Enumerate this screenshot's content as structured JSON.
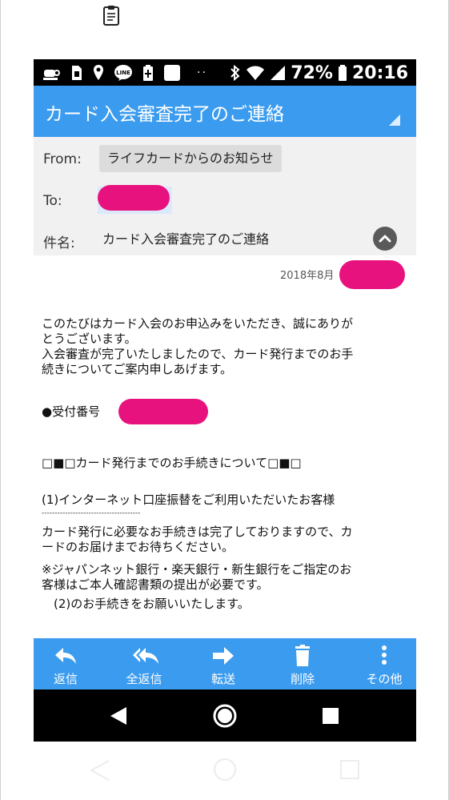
{
  "status_bar": {
    "battery_percent": "72%",
    "time": "20:16",
    "dots": "··"
  },
  "mail": {
    "title": "カード入会審査完了のご連絡",
    "from_label": "From:",
    "from_value": "ライフカードからのお知らせ",
    "to_label": "To:",
    "subject_label": "件名:",
    "subject_value": "カード入会審査完了のご連絡",
    "date": "2018年8月",
    "body_lines": [
      "このたびはカード入会のお申込みをいただき、誠にありが",
      "とうございます。",
      "入会審査が完了いたしましたので、カード発行までのお手",
      "続きについてご案内申しあげます。",
      "●受付番号",
      "□■□カード発行までのお手続きについて□■□",
      "(1)インターネット口座振替をご利用いただいたお客様",
      "--------------------------------------",
      "カード発行に必要なお手続きは完了しておりますので、カ",
      "ードのお届けまでお待ちください。",
      "※ジャパンネット銀行・楽天銀行・新生銀行をご指定のお",
      "客様はご本人確認書類の提出が必要です。",
      "　(2)のお手続きをお願いいたします。"
    ]
  },
  "toolbar": {
    "reply": "返信",
    "reply_all": "全返信",
    "forward": "転送",
    "delete": "削除",
    "more": "その他"
  },
  "colors": {
    "accent": "#3b9cef",
    "header_bg": "#f1f1f1",
    "redaction": "#e8127f"
  }
}
